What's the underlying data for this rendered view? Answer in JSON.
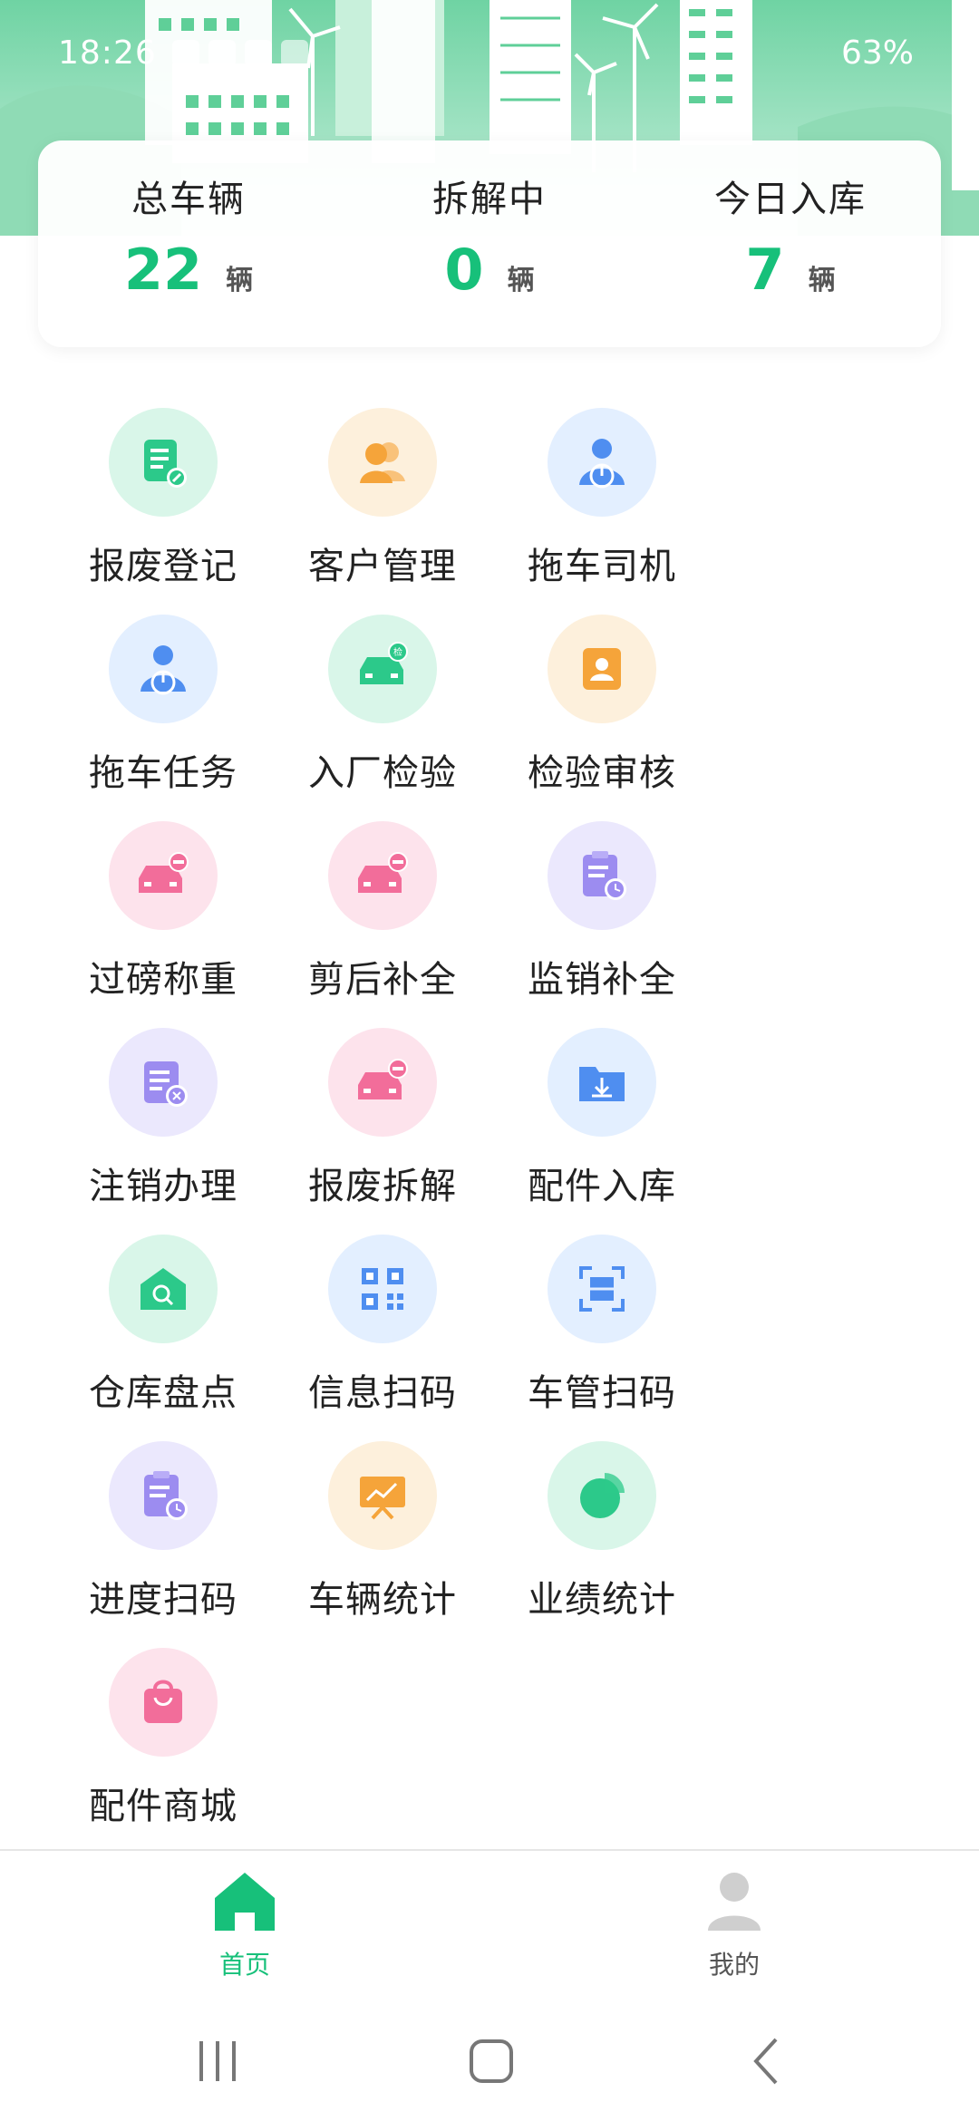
{
  "status_bar": {
    "time": "18:26",
    "battery": "63%"
  },
  "stats": [
    {
      "label": "总车辆",
      "value": "22",
      "unit": "辆"
    },
    {
      "label": "拆解中",
      "value": "0",
      "unit": "辆"
    },
    {
      "label": "今日入库",
      "value": "7",
      "unit": "辆"
    }
  ],
  "grid": {
    "items": [
      {
        "label": "报废登记",
        "icon": "scrap-register-icon",
        "color": "#2cc98a",
        "bg": "#d9f6e9"
      },
      {
        "label": "客户管理",
        "icon": "customers-icon",
        "color": "#f5a43a",
        "bg": "#fdf0dc"
      },
      {
        "label": "拖车司机",
        "icon": "driver-icon",
        "color": "#4f8ef0",
        "bg": "#e3efff"
      },
      {
        "label": "拖车任务",
        "icon": "driver-task-icon",
        "color": "#4f8ef0",
        "bg": "#e3efff"
      },
      {
        "label": "入厂检验",
        "icon": "car-inspect-icon",
        "color": "#2cc98a",
        "bg": "#d9f6e9"
      },
      {
        "label": "检验审核",
        "icon": "contact-card-icon",
        "color": "#f5a43a",
        "bg": "#fdf0dc"
      },
      {
        "label": "过磅称重",
        "icon": "car-minus-icon",
        "color": "#f26d9a",
        "bg": "#fde3ec"
      },
      {
        "label": "剪后补全",
        "icon": "car-minus-icon",
        "color": "#f26d9a",
        "bg": "#fde3ec"
      },
      {
        "label": "监销补全",
        "icon": "clipboard-clock-icon",
        "color": "#9c8cf0",
        "bg": "#ebe8fd"
      },
      {
        "label": "注销办理",
        "icon": "doc-cancel-icon",
        "color": "#9c8cf0",
        "bg": "#ebe8fd"
      },
      {
        "label": "报废拆解",
        "icon": "car-minus-icon",
        "color": "#f26d9a",
        "bg": "#fde3ec"
      },
      {
        "label": "配件入库",
        "icon": "folder-download-icon",
        "color": "#4f8ef0",
        "bg": "#e3efff"
      },
      {
        "label": "仓库盘点",
        "icon": "warehouse-search-icon",
        "color": "#2cc98a",
        "bg": "#d9f6e9"
      },
      {
        "label": "信息扫码",
        "icon": "qr-code-icon",
        "color": "#4f8ef0",
        "bg": "#e3efff"
      },
      {
        "label": "车管扫码",
        "icon": "scan-frame-icon",
        "color": "#4f8ef0",
        "bg": "#e3efff"
      },
      {
        "label": "进度扫码",
        "icon": "progress-clipboard-icon",
        "color": "#9c8cf0",
        "bg": "#ebe8fd"
      },
      {
        "label": "车辆统计",
        "icon": "presentation-chart-icon",
        "color": "#f5a43a",
        "bg": "#fdf0dc"
      },
      {
        "label": "业绩统计",
        "icon": "pie-chart-icon",
        "color": "#2cc98a",
        "bg": "#d9f6e9"
      },
      {
        "label": "配件商城",
        "icon": "shopping-bag-icon",
        "color": "#f26d9a",
        "bg": "#fde3ec"
      }
    ]
  },
  "bottom_nav": {
    "items": [
      {
        "label": "首页",
        "icon": "home-icon",
        "active": true
      },
      {
        "label": "我的",
        "icon": "person-icon",
        "active": false
      }
    ],
    "active_color": "#17c07a",
    "inactive_color": "#555555"
  }
}
